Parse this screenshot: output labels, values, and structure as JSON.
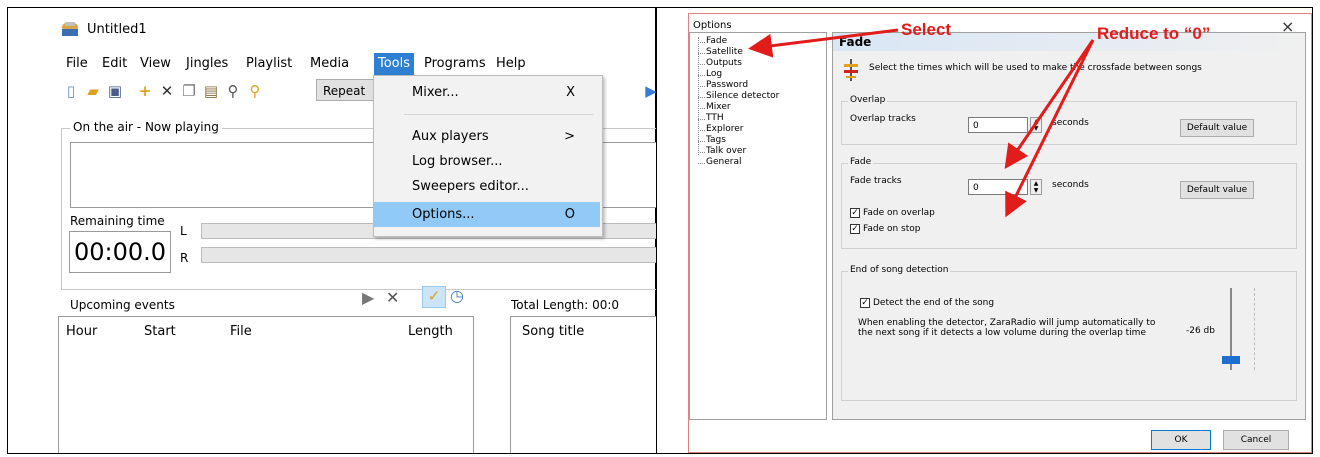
{
  "left": {
    "title": "Untitled1",
    "menu": [
      "File",
      "Edit",
      "View",
      "Jingles",
      "Playlist",
      "Media",
      "Tools",
      "Programs",
      "Help"
    ],
    "active_menu": "Tools",
    "repeat_label": "Repeat",
    "on_air_label": "On the air - Now playing",
    "remaining_label": "Remaining time",
    "time_value": "00:00.0",
    "channel_l": "L",
    "channel_r": "R",
    "tools_menu": [
      {
        "label": "Mixer...",
        "key": "X"
      },
      {
        "label": "Aux players",
        "key": ">"
      },
      {
        "label": "Log browser...",
        "key": ""
      },
      {
        "label": "Sweepers editor...",
        "key": ""
      },
      {
        "label": "Options...",
        "key": "O"
      }
    ],
    "upcoming_label": "Upcoming events",
    "total_length_label": "Total Length: 00:0",
    "columns": [
      "Hour",
      "Start",
      "File",
      "Length"
    ],
    "song_title_col": "Song title"
  },
  "right": {
    "title": "Options",
    "close_glyph": "×",
    "tree_items": [
      "Fade",
      "Satellite",
      "Outputs",
      "Log",
      "Password",
      "Silence detector",
      "Mixer",
      "TTH",
      "Explorer",
      "Tags",
      "Talk over",
      "General"
    ],
    "panel_title": "Fade",
    "description": "Select the times which will be used to make the crossfade between songs",
    "overlap_group": "Overlap",
    "overlap_label": "Overlap tracks",
    "overlap_value": "0",
    "seconds": "seconds",
    "default_value": "Default value",
    "fade_group": "Fade",
    "fade_label": "Fade tracks",
    "fade_value": "0",
    "fade_on_overlap": "Fade on overlap",
    "fade_on_stop": "Fade on stop",
    "eos_group": "End of song detection",
    "detect_label": "Detect the end of the song",
    "detect_desc_1": "When enabling the detector, ZaraRadio will jump automatically to",
    "detect_desc_2": "the next song if it detects a low volume during the overlap time",
    "db_value": "-26 db",
    "ok": "OK",
    "cancel": "Cancel"
  },
  "annotations": {
    "select": "Select",
    "reduce": "Reduce to “0”",
    "color": "#e21b1b"
  }
}
